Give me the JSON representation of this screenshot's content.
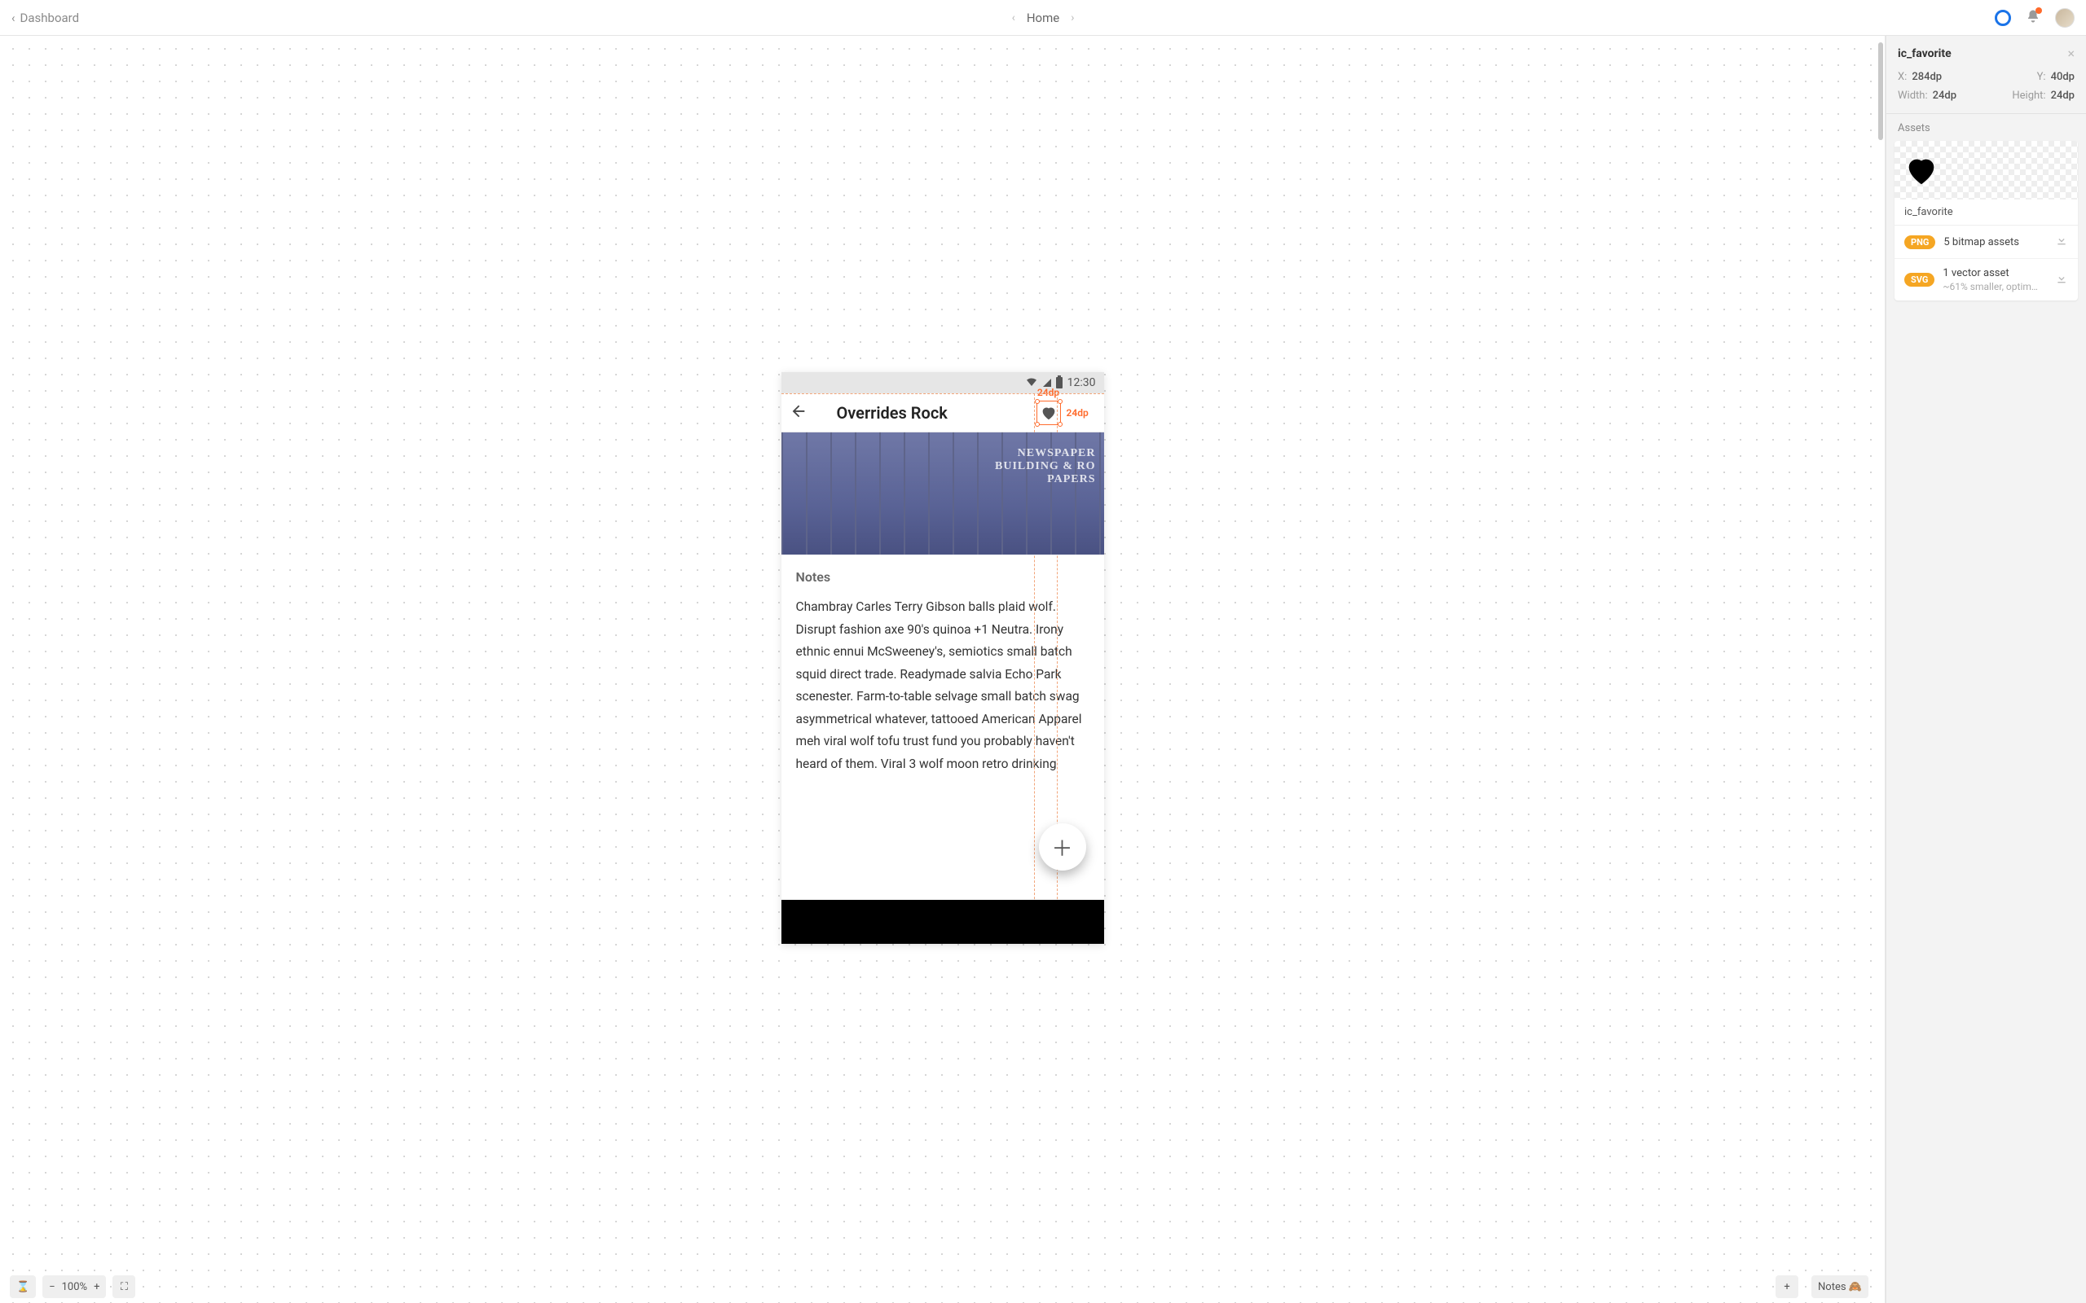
{
  "topbar": {
    "back_label": "Dashboard",
    "breadcrumb": "Home"
  },
  "inspector": {
    "title": "ic_favorite",
    "x_label": "X:",
    "x_value": "284dp",
    "y_label": "Y:",
    "y_value": "40dp",
    "w_label": "Width:",
    "w_value": "24dp",
    "h_label": "Height:",
    "h_value": "24dp",
    "assets_label": "Assets",
    "asset_name": "ic_favorite",
    "png_pill": "PNG",
    "png_text": "5 bitmap assets",
    "svg_pill": "SVG",
    "svg_text": "1 vector asset",
    "svg_sub": "~61% smaller, optim…"
  },
  "phone": {
    "clock": "12:30",
    "title": "Overrides Rock",
    "measure_top": "24dp",
    "measure_right": "24dp",
    "notes_heading": "Notes",
    "notes_body": "Chambray Carles Terry Gibson balls plaid wolf. Disrupt fashion axe 90's quinoa +1 Neutra. Irony ethnic ennui McSweeney's, semiotics small batch squid direct trade. Readymade salvia Echo Park scenester. Farm-to-table selvage small batch swag asymmetrical whatever, tattooed American Apparel meh viral wolf tofu trust fund you probably haven't heard of them. Viral 3 wolf moon retro drinking"
  },
  "bottombar": {
    "zoom": "100%",
    "notes_btn": "Notes 🙈"
  }
}
